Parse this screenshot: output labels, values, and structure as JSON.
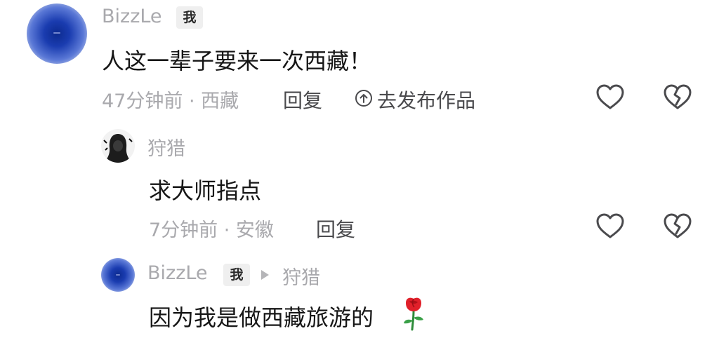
{
  "comments": [
    {
      "author": "BizzLe",
      "badge": "我",
      "text": "人这一辈子要来一次西藏！",
      "meta": "47分钟前 · 西藏",
      "reply_label": "回复",
      "publish_label": "去发布作品"
    },
    {
      "author": "狩猎",
      "text": "求大师指点",
      "meta": "7分钟前 · 安徽",
      "reply_label": "回复"
    },
    {
      "author": "BizzLe",
      "badge": "我",
      "reply_to": "狩猎",
      "text": "因为我是做西藏旅游的"
    }
  ],
  "icons": {
    "like": "heart-outline-icon",
    "dislike": "broken-heart-icon",
    "publish": "arrow-up-circle-icon",
    "reply_arrow": "triangle-right-icon",
    "emoji": "rose-emoji-icon"
  },
  "colors": {
    "primary_text": "#161616",
    "secondary_text": "#a9a9ad",
    "action_text": "#4a4a4d",
    "badge_bg": "#efefef",
    "avatar_blue": "#1a3cb0"
  }
}
